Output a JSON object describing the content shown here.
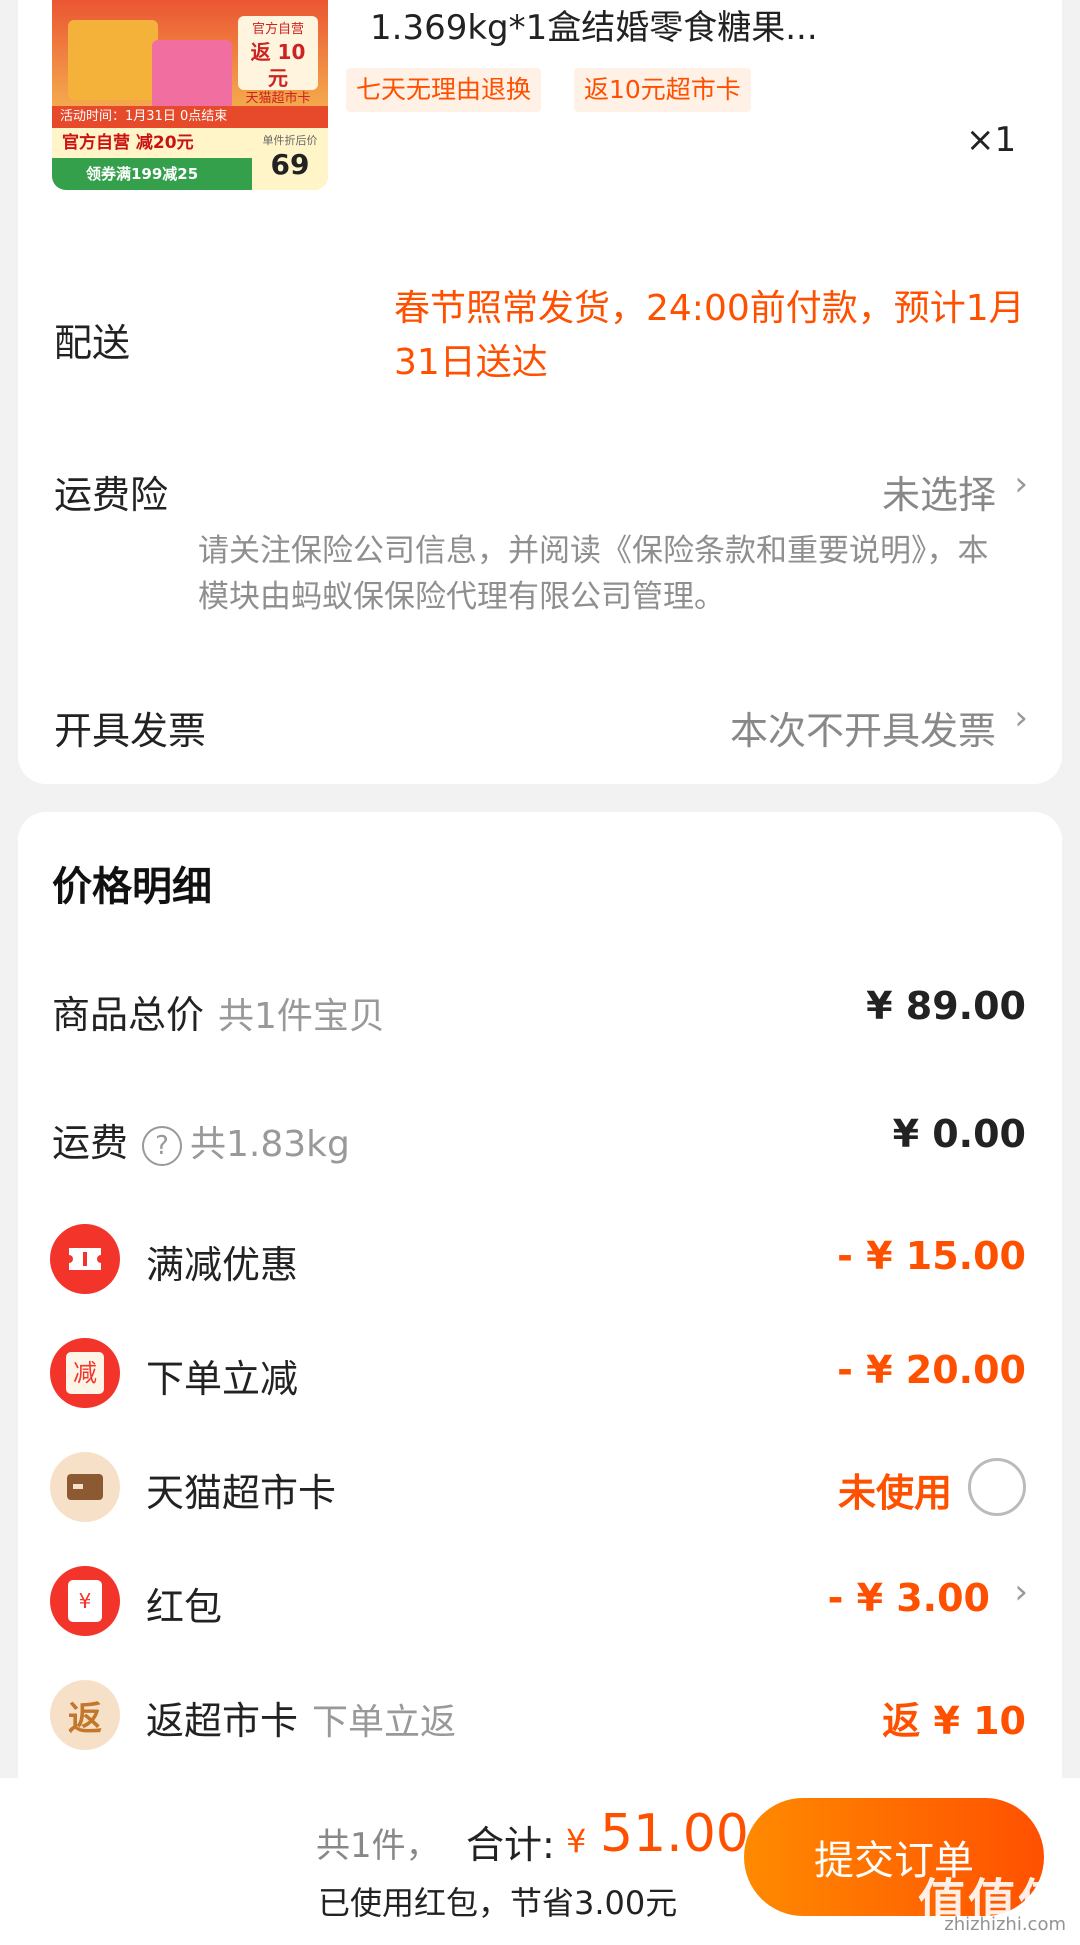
{
  "product": {
    "title": "1.369kg*1盒结婚零食糖果...",
    "image": {
      "promo_top": "官方自营",
      "promo_return": "返 10 元",
      "promo_card": "天猫超市卡",
      "activity": "活动时间：1月31日 0点结束",
      "self_operated": "官方自营 减20元",
      "coupon": "领券满199减25",
      "unit_price_label": "单件折后价",
      "unit_price": "69"
    },
    "tags": [
      "七天无理由退换",
      "返10元超市卡"
    ],
    "quantity": "×1"
  },
  "delivery": {
    "label": "配送",
    "text": "春节照常发货，24:00前付款，预计1月31日送达"
  },
  "insurance": {
    "label": "运费险",
    "value": "未选择",
    "note": "请关注保险公司信息，并阅读《保险条款和重要说明》，本模块由蚂蚁保保险代理有限公司管理。"
  },
  "invoice": {
    "label": "开具发票",
    "value": "本次不开具发票"
  },
  "price_detail": {
    "title": "价格明细",
    "goods_total": {
      "label": "商品总价",
      "sub": "共1件宝贝",
      "value": "¥ 89.00"
    },
    "shipping": {
      "label": "运费",
      "sub": "共1.83kg",
      "value": "¥ 0.00"
    },
    "full_reduction": {
      "label": "满减优惠",
      "value": "- ¥ 15.00"
    },
    "order_discount": {
      "label": "下单立减",
      "icon_text": "减",
      "value": "- ¥ 20.00"
    },
    "tmall_card": {
      "label": "天猫超市卡",
      "value": "未使用"
    },
    "red_packet": {
      "label": "红包",
      "icon_text": "¥",
      "value": "- ¥ 3.00"
    },
    "return_card": {
      "label": "返超市卡",
      "icon_text": "返",
      "sub": "下单立返",
      "value": "返 ¥ 10"
    }
  },
  "bottom": {
    "count": "共1件，",
    "total_label": "合计:",
    "yen": "¥",
    "amount": "51.00",
    "saved": "已使用红包，节省3.00元",
    "submit": "提交订单"
  },
  "watermark": {
    "text": "值值值",
    "sub": "zhizhizhi.com"
  },
  "colors": {
    "accent": "#ff5000",
    "red_icon": "#f2342a",
    "beige_icon": "#f7e0c8"
  }
}
